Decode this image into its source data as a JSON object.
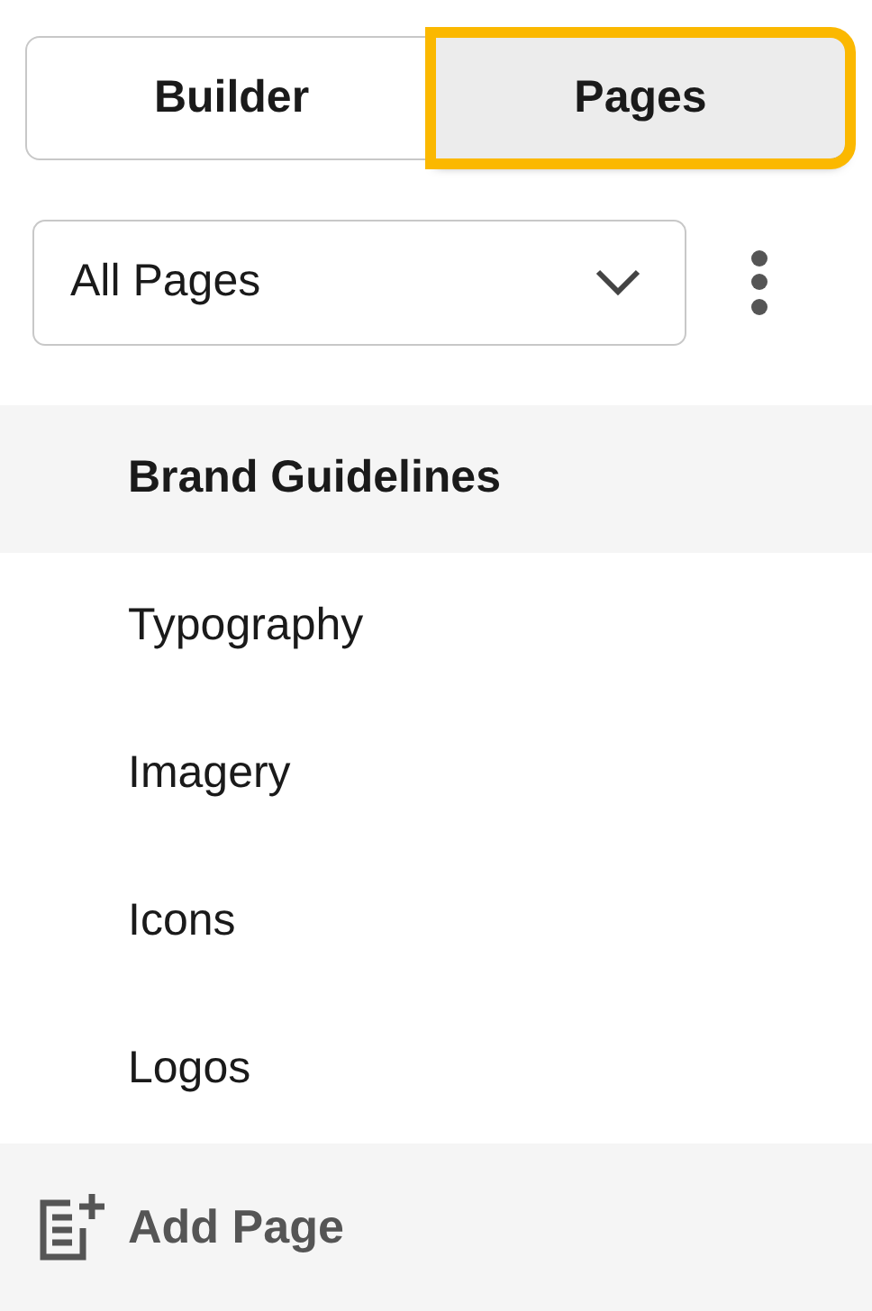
{
  "tabs": [
    {
      "label": "Builder",
      "selected": false,
      "highlighted": false
    },
    {
      "label": "Pages",
      "selected": true,
      "highlighted": true
    }
  ],
  "filter": {
    "value": "All Pages"
  },
  "pages": [
    {
      "label": "Brand Guidelines",
      "selected": true
    },
    {
      "label": "Typography",
      "selected": false
    },
    {
      "label": "Imagery",
      "selected": false
    },
    {
      "label": "Icons",
      "selected": false
    },
    {
      "label": "Logos",
      "selected": false
    }
  ],
  "add_button": {
    "label": "Add Page"
  }
}
